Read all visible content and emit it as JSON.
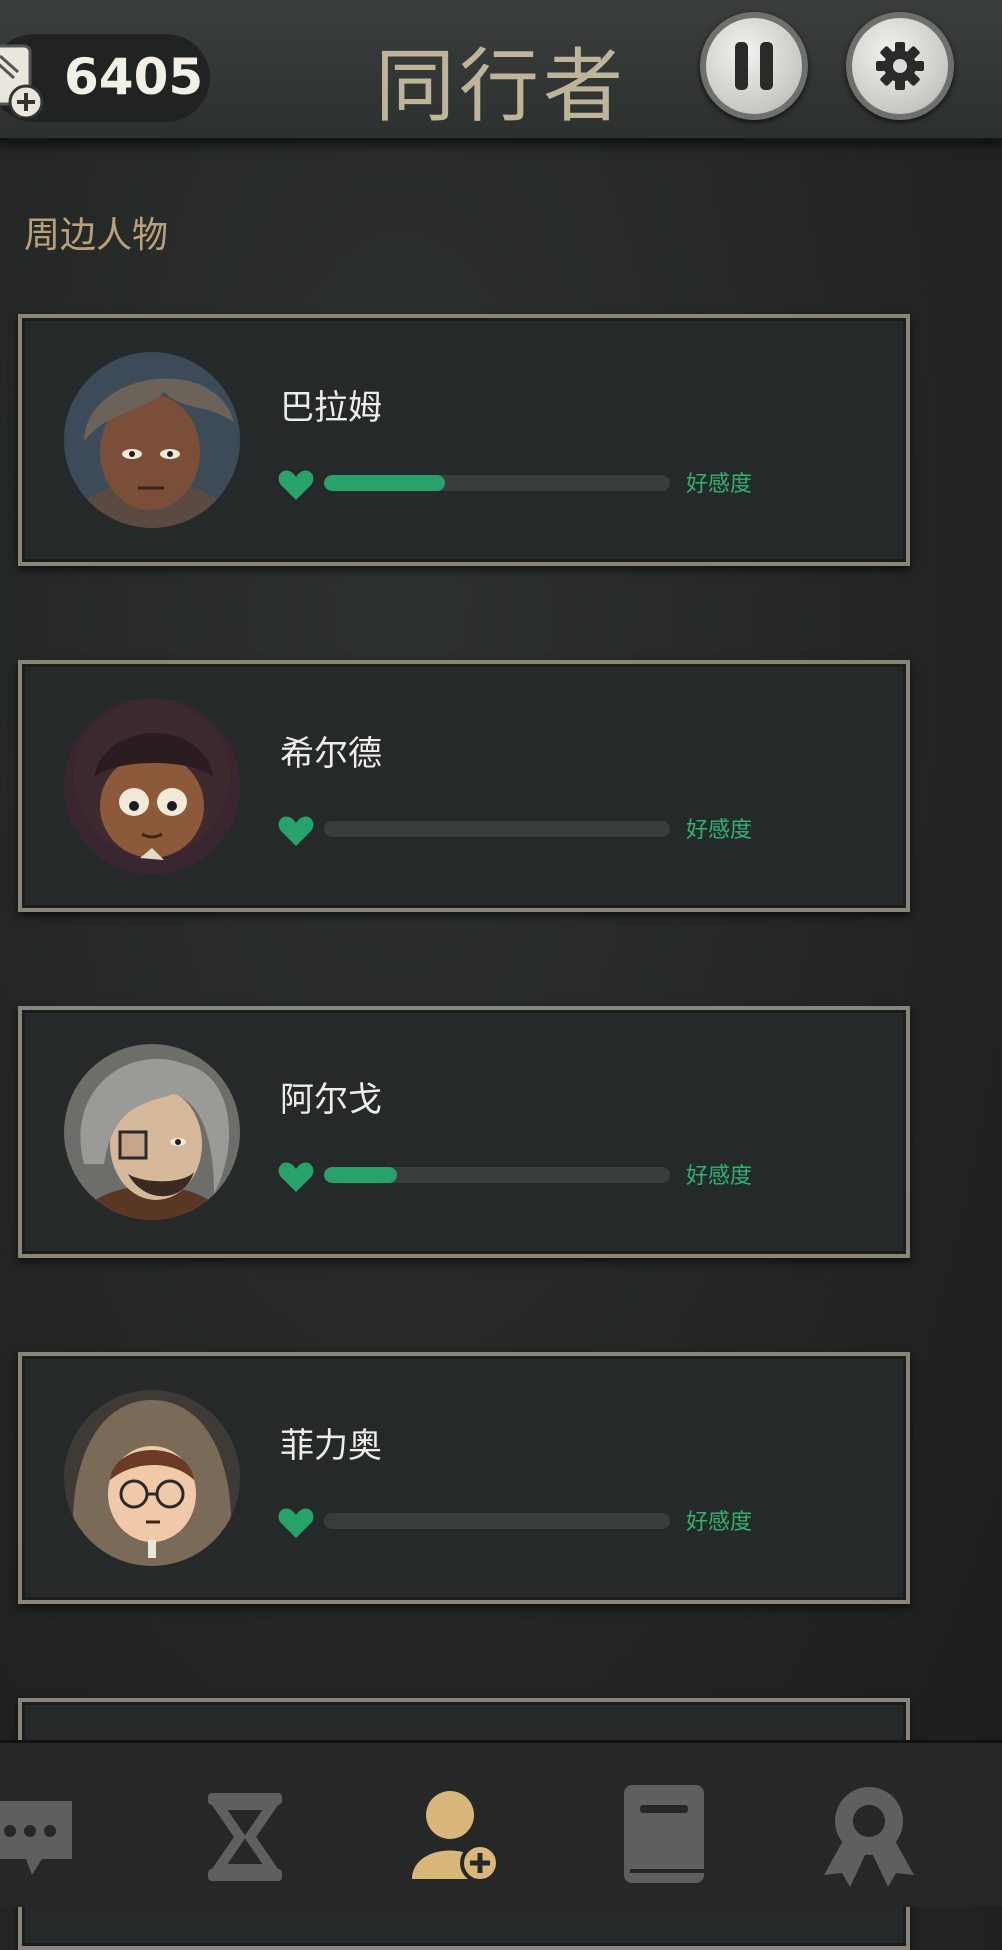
{
  "header": {
    "currency_value": "6405",
    "title": "同行者",
    "pause_icon": "pause-icon",
    "settings_icon": "gear-icon"
  },
  "section": {
    "heading": "周边人物"
  },
  "companions": [
    {
      "name": "巴拉姆",
      "affection_label": "好感度",
      "affection": 0.35
    },
    {
      "name": "希尔德",
      "affection_label": "好感度",
      "affection": 0.0
    },
    {
      "name": "阿尔戈",
      "affection_label": "好感度",
      "affection": 0.21
    },
    {
      "name": "菲力奥",
      "affection_label": "好感度",
      "affection": 0.0
    }
  ],
  "bottom_nav": [
    {
      "icon": "chat-icon",
      "active": false
    },
    {
      "icon": "hourglass-icon",
      "active": false
    },
    {
      "icon": "add-companion-icon",
      "active": true
    },
    {
      "icon": "book-icon",
      "active": false
    },
    {
      "icon": "ribbon-badge-icon",
      "active": false
    }
  ],
  "colors": {
    "accent_green": "#27a26a",
    "heading_gold": "#b8a27a",
    "nav_active": "#d9b779",
    "nav_inactive": "#5e605d"
  }
}
